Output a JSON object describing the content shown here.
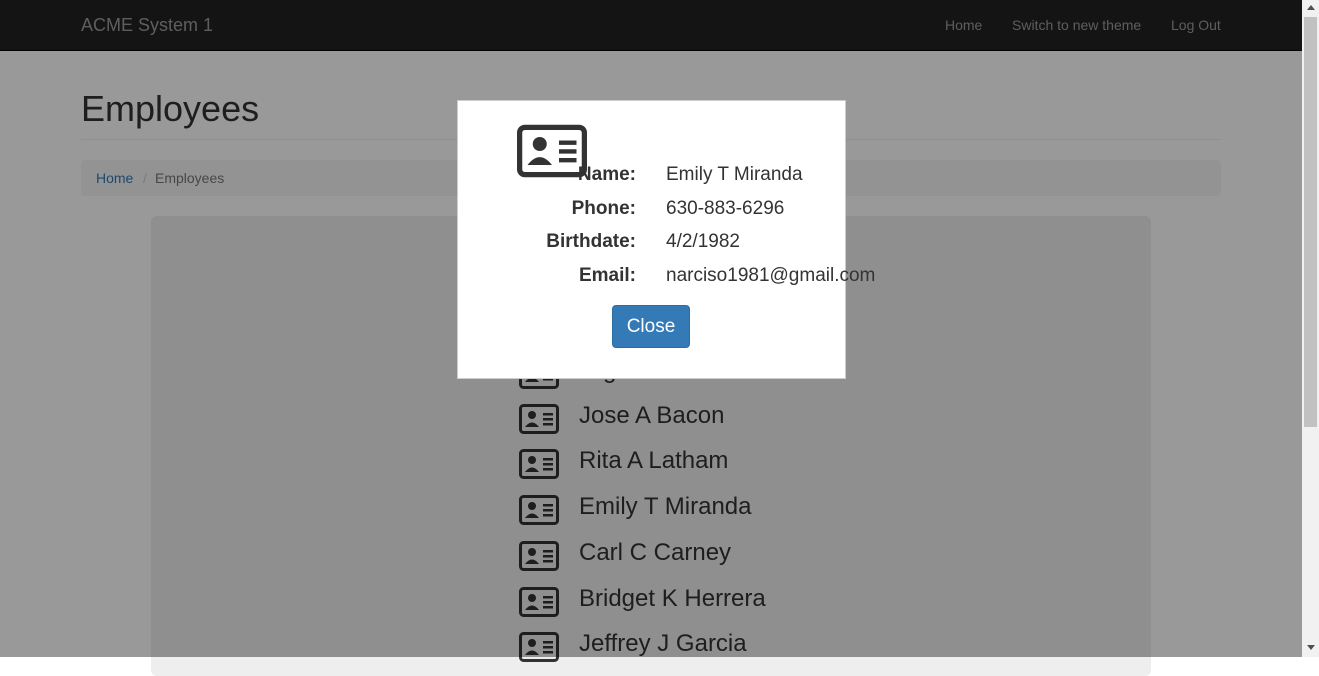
{
  "navbar": {
    "brand": "ACME System 1",
    "links": [
      "Home",
      "Switch to new theme",
      "Log Out"
    ]
  },
  "page": {
    "title": "Employees",
    "breadcrumb": {
      "home": "Home",
      "separator": "/",
      "current": "Employees"
    }
  },
  "employees": [
    "Olga V Hunter",
    "Jose A Bacon",
    "Rita A Latham",
    "Emily T Miranda",
    "Carl C Carney",
    "Bridget K Herrera",
    "Jeffrey J Garcia"
  ],
  "modal": {
    "icon": "id-card-icon",
    "fields": [
      {
        "label": "Name:",
        "value": "Emily T Miranda"
      },
      {
        "label": "Phone:",
        "value": "630-883-6296"
      },
      {
        "label": "Birthdate:",
        "value": "4/2/1982"
      },
      {
        "label": "Email:",
        "value": "narciso1981@gmail.com"
      }
    ],
    "close_label": "Close"
  },
  "colors": {
    "navbar_bg": "#222222",
    "primary_button": "#337ab7",
    "link": "#337ab7"
  }
}
